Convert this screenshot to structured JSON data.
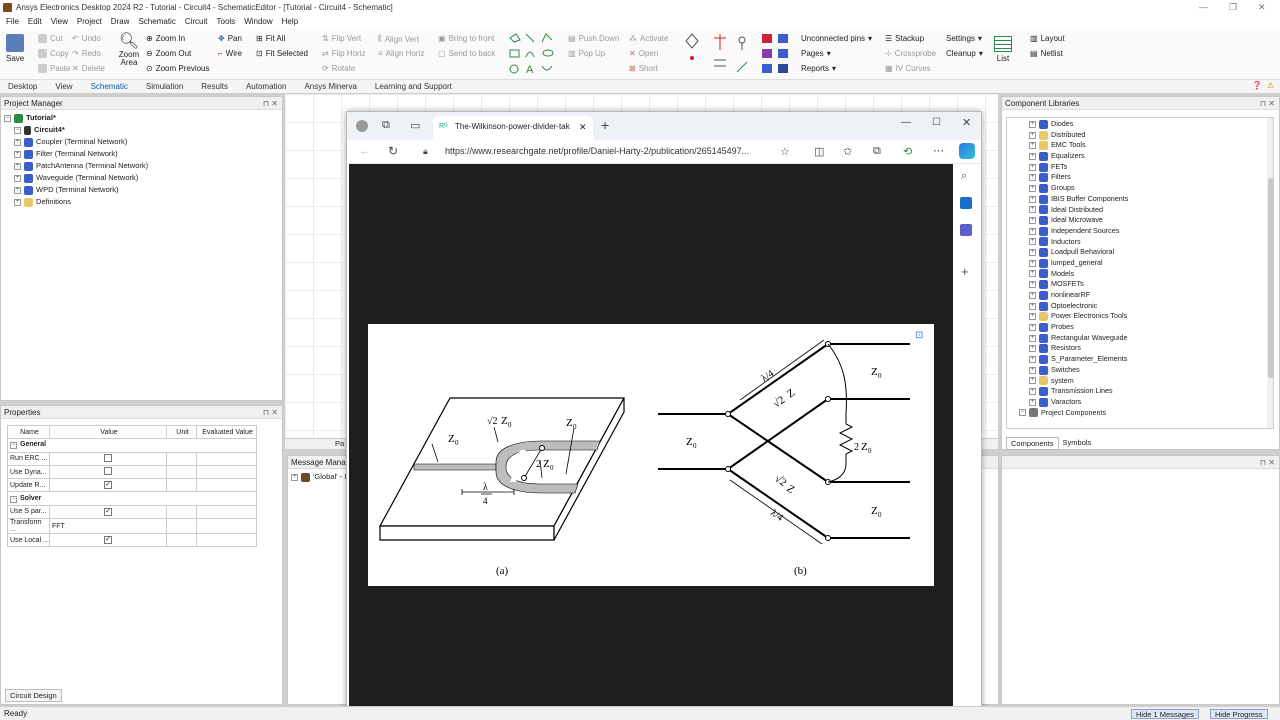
{
  "window": {
    "title": "Ansys Electronics Desktop 2024 R2 - Tutorial - Circuit4 - SchematicEditor - [Tutorial - Circuit4 - Schematic]"
  },
  "menu": [
    "File",
    "Edit",
    "View",
    "Project",
    "Draw",
    "Schematic",
    "Circuit",
    "Tools",
    "Window",
    "Help"
  ],
  "ribbon": {
    "save": "Save",
    "cut": "Cut",
    "copy": "Copy",
    "paste": "Paste",
    "undo": "Undo",
    "redo": "Redo",
    "delete": "Delete",
    "zoom_area": "Zoom Area",
    "zoom_in": "Zoom In",
    "zoom_out": "Zoom Out",
    "zoom_previous": "Zoom Previous",
    "pan": "Pan",
    "wire": "Wire",
    "fit_all": "Fit All",
    "fit_selected": "Fit Selected",
    "flip_vert": "Flip Vert",
    "flip_horiz": "Flip Horiz",
    "rotate": "Rotate",
    "align_vert": "Align Vert",
    "align_horiz": "Align Horiz",
    "bring_to_front": "Bring to front",
    "send_to_back": "Send to back",
    "push_down": "Push Down",
    "pop_up": "Pop Up",
    "activate": "Activate",
    "open": "Open",
    "short": "Short",
    "unconnected_pins": "Unconnected pins",
    "pages": "Pages",
    "reports": "Reports",
    "stackup": "Stackup",
    "crossprobe": "Crossprobe",
    "iv_curves": "IV Curves",
    "settings": "Settings",
    "cleanup": "Cleanup",
    "list": "List",
    "layout": "Layout",
    "netlist": "Netlist"
  },
  "tabs": [
    "Desktop",
    "View",
    "Schematic",
    "Simulation",
    "Results",
    "Automation",
    "Ansys Minerva",
    "Learning and Support"
  ],
  "project_manager": {
    "title": "Project Manager",
    "root": "Tutorial*",
    "items": [
      "Circuit4*",
      "Coupler (Terminal Network)",
      "Filter (Terminal Network)",
      "PatchAntenna (Terminal Network)",
      "Waveguide (Terminal Network)",
      "WPD (Terminal Network)",
      "Definitions"
    ]
  },
  "properties": {
    "title": "Properties",
    "headers": [
      "Name",
      "Value",
      "Unit",
      "Evaluated Value"
    ],
    "general": "General",
    "general_rows": [
      {
        "name": "Run ERC ...",
        "checked": false
      },
      {
        "name": "Use Dyna...",
        "checked": false
      },
      {
        "name": "Update R...",
        "checked": true
      }
    ],
    "solver": "Solver",
    "solver_rows": [
      {
        "name": "Use S par...",
        "checked": true,
        "value": ""
      },
      {
        "name": "Transform ...",
        "checked": null,
        "value": "FFT"
      },
      {
        "name": "Use Local ...",
        "checked": true,
        "value": ""
      }
    ],
    "footer_tab": "Circuit Design"
  },
  "message_manager": {
    "title": "Message Manag",
    "item": "'Global' - I"
  },
  "canvas_tab": "Pa",
  "component_libraries": {
    "title": "Component Libraries",
    "items": [
      "Diodes",
      "Distributed",
      "EMC Tools",
      "Equalizers",
      "FETs",
      "Filters",
      "Groups",
      "IBIS Buffer Components",
      "Ideal Distributed",
      "Ideal Microwave",
      "Independent Sources",
      "Inductors",
      "Loadpull Behavioral",
      "lumped_general",
      "Models",
      "MOSFETs",
      "nonlinearRF",
      "Optoelectronic",
      "Power Electronics Tools",
      "Probes",
      "Rectangular Waveguide",
      "Resistors",
      "S_Parameter_Elements",
      "Switches",
      "system",
      "Transmission Lines",
      "Varactors"
    ],
    "project_components": "Project Components",
    "tabs": [
      "Components",
      "Symbols"
    ]
  },
  "browser": {
    "tab_title": "The-Wilkinson-power-divider-tak",
    "url": "https://www.researchgate.net/profile/Daniel-Harty-2/publication/265145497..."
  },
  "figure": {
    "label_a": "(a)",
    "label_b": "(b)",
    "z0": "Z",
    "sub0": "0",
    "sqrt2": "√2",
    "two": "2",
    "lambda": "λ",
    "four": "4",
    "lambda_over_4": "λ/4"
  },
  "status": {
    "text": "Ready",
    "hide_messages": "Hide 1 Messages",
    "hide_progress": "Hide Progress"
  },
  "colors": {
    "accent": "#0b5fb0",
    "browser_bg": "#1e1e1e"
  }
}
